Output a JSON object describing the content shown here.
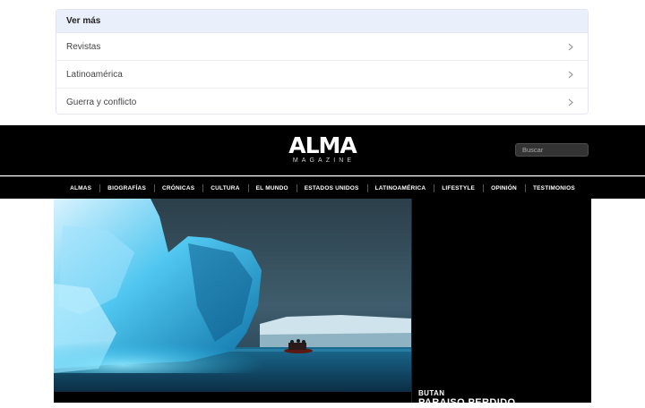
{
  "more": {
    "title": "Ver más",
    "items": [
      {
        "label": "Revistas"
      },
      {
        "label": "Latinoamérica"
      },
      {
        "label": "Guerra y conflicto"
      }
    ]
  },
  "header": {
    "logo_main": "ALMA",
    "logo_sub": "MAGAZINE",
    "search_placeholder": "Buscar"
  },
  "nav": {
    "items": [
      "ALMAS",
      "BIOGRAFÍAS",
      "CRÓNICAS",
      "CULTURA",
      "EL MUNDO",
      "ESTADOS UNIDOS",
      "LATINOAMÉRICA",
      "LIFESTYLE",
      "OPINIÓN",
      "TESTIMONIOS"
    ]
  },
  "feature": {
    "kicker": "BUTAN",
    "headline": "PARAISO PERDIDO"
  },
  "colors": {
    "header_bg": "#000000",
    "card_head_bg": "#eaf0fb",
    "accent_ice": "#1fb6e6"
  },
  "icons": {
    "row_icon": "chevron-right-icon"
  }
}
